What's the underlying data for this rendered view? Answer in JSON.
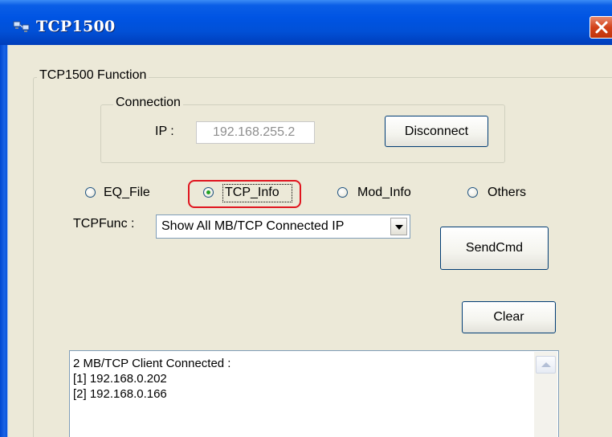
{
  "window": {
    "title": "TCP1500"
  },
  "function_group": {
    "title": "TCP1500 Function"
  },
  "connection": {
    "title": "Connection",
    "ip_label": "IP :",
    "ip_value": "192.168.255.2",
    "disconnect_label": "Disconnect"
  },
  "radios": [
    {
      "label": "EQ_File",
      "checked": false
    },
    {
      "label": "TCP_Info",
      "checked": true
    },
    {
      "label": "Mod_Info",
      "checked": false
    },
    {
      "label": "Others",
      "checked": false
    }
  ],
  "tcpfunc": {
    "label": "TCPFunc :",
    "selected": "Show All MB/TCP Connected IP"
  },
  "buttons": {
    "sendcmd": "SendCmd",
    "clear": "Clear"
  },
  "output": {
    "lines": [
      "2 MB/TCP Client Connected :",
      "[1] 192.168.0.202",
      "[2] 192.168.0.166"
    ]
  },
  "colors": {
    "title_bar": "#0054e3",
    "highlight_border": "#e0141e",
    "close_button": "#d2421a"
  },
  "icons": {
    "app": "network-computers-icon",
    "close": "close-x-icon"
  }
}
